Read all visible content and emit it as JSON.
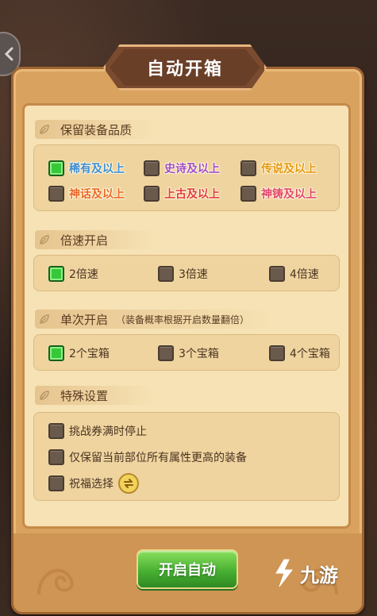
{
  "title": "自动开箱",
  "quality_section": {
    "label": "保留装备品质",
    "options": [
      {
        "label": "稀有及以上",
        "checked": true,
        "color": "#3f8fd6"
      },
      {
        "label": "史诗及以上",
        "checked": false,
        "color": "#a24fc9"
      },
      {
        "label": "传说及以上",
        "checked": false,
        "color": "#e59a14"
      },
      {
        "label": "神话及以上",
        "checked": false,
        "color": "#ea6a2a"
      },
      {
        "label": "上古及以上",
        "checked": false,
        "color": "#e23d3d"
      },
      {
        "label": "神铸及以上",
        "checked": false,
        "color": "#e0486e"
      }
    ]
  },
  "speed_section": {
    "label": "倍速开启",
    "options": [
      {
        "label": "2倍速",
        "checked": true
      },
      {
        "label": "3倍速",
        "checked": false
      },
      {
        "label": "4倍速",
        "checked": false
      }
    ]
  },
  "single_section": {
    "label": "单次开启",
    "note": "（装备概率根据开启数量翻倍）",
    "options": [
      {
        "label": "2个宝箱",
        "checked": true
      },
      {
        "label": "3个宝箱",
        "checked": false
      },
      {
        "label": "4个宝箱",
        "checked": false
      }
    ]
  },
  "special_section": {
    "label": "特殊设置",
    "options": [
      {
        "label": "挑战券满时停止",
        "checked": false
      },
      {
        "label": "仅保留当前部位所有属性更高的装备",
        "checked": false
      },
      {
        "label": "祝福选择",
        "checked": false
      }
    ]
  },
  "start_button": "开启自动",
  "watermark": "九游",
  "icons": {
    "back": "chevron-left-icon",
    "section": "leaf-icon",
    "swap": "swap-icon",
    "logo": "jiuyou-logo-icon"
  }
}
